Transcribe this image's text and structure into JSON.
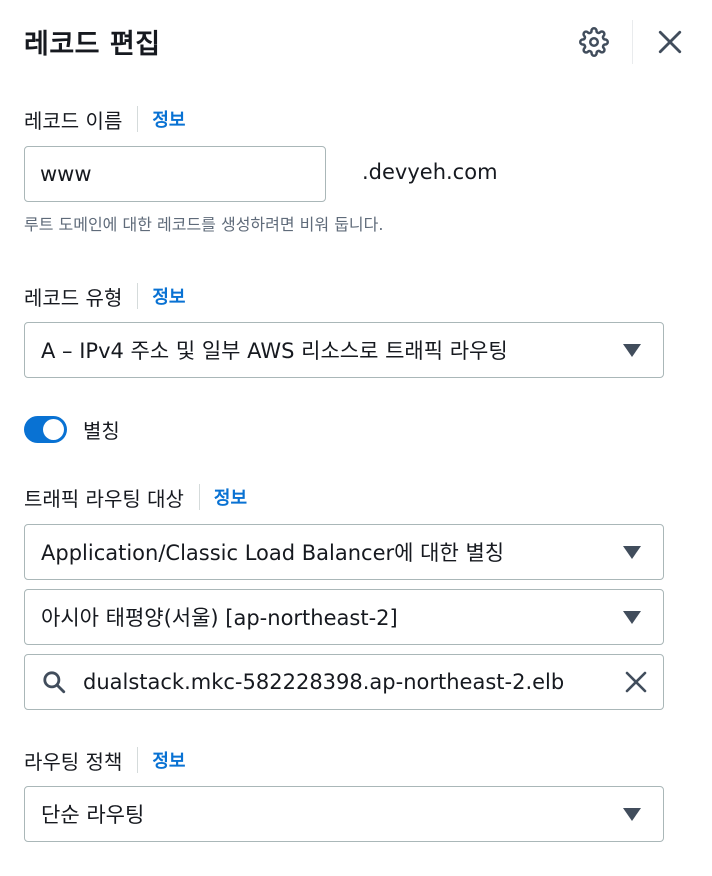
{
  "header": {
    "title": "레코드 편집",
    "settings_icon": "gear-icon",
    "close_icon": "close-icon"
  },
  "record_name": {
    "label": "레코드 이름",
    "info": "정보",
    "value": "www",
    "domain_suffix": ".devyeh.com",
    "hint": "루트 도메인에 대한 레코드를 생성하려면 비워 둡니다."
  },
  "record_type": {
    "label": "레코드 유형",
    "info": "정보",
    "selected": "A – IPv4 주소 및 일부 AWS 리소스로 트래픽 라우팅"
  },
  "alias": {
    "label": "별칭",
    "enabled": true
  },
  "traffic_target": {
    "label": "트래픽 라우팅 대상",
    "info": "정보",
    "endpoint_type": "Application/Classic Load Balancer에 대한 별칭",
    "region": "아시아 태평양(서울) [ap-northeast-2]",
    "load_balancer": "dualstack.mkc-582228398.ap-northeast-2.elb"
  },
  "routing_policy": {
    "label": "라우팅 정책",
    "info": "정보",
    "selected": "단순 라우팅"
  },
  "colors": {
    "accent": "#0972d3",
    "text": "#16191f",
    "hint": "#5f6b7a",
    "border": "#aab7b8"
  }
}
